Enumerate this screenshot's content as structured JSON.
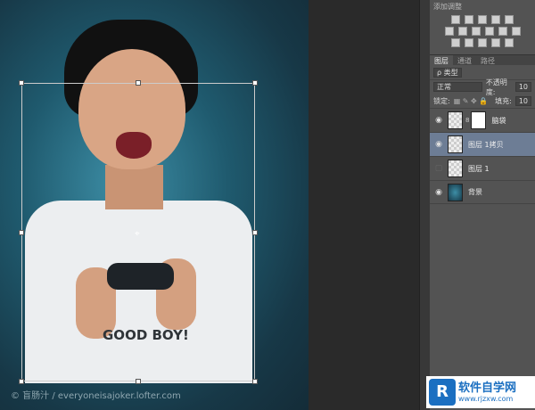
{
  "canvas": {
    "credit": "© 盲肠汁 / everyoneisajoker.lofter.com",
    "shirt_text": "GOOD BOY!"
  },
  "panel": {
    "adjust_title": "添加调整",
    "tabs": [
      "图层",
      "通道",
      "路径"
    ],
    "filter_label": "ρ 类型",
    "blend_mode": "正常",
    "opacity_label": "不透明度:",
    "opacity_value": "10",
    "lock_label": "锁定:",
    "fill_label": "填充:",
    "fill_value": "10",
    "layers": [
      {
        "name": "脑袋",
        "visible": true,
        "mask": true
      },
      {
        "name": "图层 1拷贝",
        "visible": true,
        "selected": true
      },
      {
        "name": "图层 1",
        "visible": false
      },
      {
        "name": "背景",
        "visible": true
      }
    ]
  },
  "watermark": {
    "brand": "软件自学网",
    "url": "www.rjzxw.com",
    "letter": "R"
  }
}
